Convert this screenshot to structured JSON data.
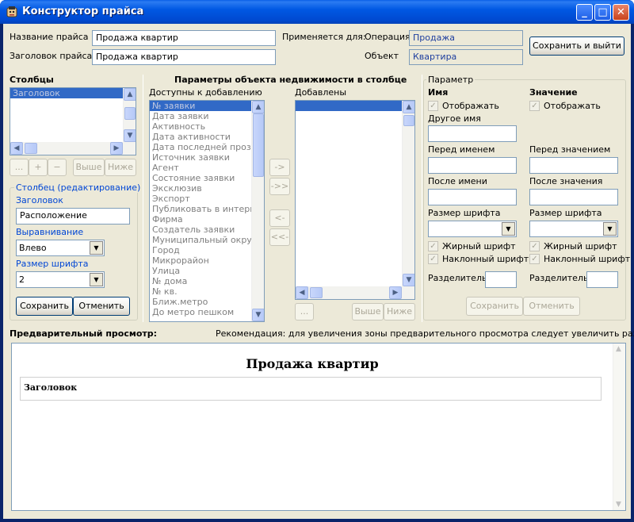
{
  "window": {
    "title": "Конструктор прайса",
    "minimize": "_",
    "maximize": "□",
    "close": "✕"
  },
  "header": {
    "price_name_label": "Название прайса",
    "price_name_value": "Продажа квартир",
    "price_title_label": "Заголовок прайса",
    "price_title_value": "Продажа квартир",
    "applies_label": "Применяется для:",
    "operation_label": "Операция",
    "operation_value": "Продажа",
    "object_label": "Объект",
    "object_value": "Квартира",
    "save_exit": "Сохранить и выйти"
  },
  "columns": {
    "title": "Столбцы",
    "items": [
      "Заголовок"
    ],
    "btn_more": "...",
    "btn_add": "+",
    "btn_remove": "−",
    "btn_up": "Выше",
    "btn_down": "Ниже"
  },
  "column_edit": {
    "title": "Столбец (редактирование)",
    "heading_label": "Заголовок",
    "heading_value": "Расположение",
    "align_label": "Выравнивание",
    "align_value": "Влево",
    "font_label": "Размер шрифта",
    "font_value": "2",
    "save": "Сохранить",
    "cancel": "Отменить"
  },
  "params": {
    "title": "Параметры объекта недвижимости в столбце",
    "available_label": "Доступны к добавлению",
    "available": [
      "№ заявки",
      "Дата заявки",
      "Активность",
      "Дата активности",
      "Дата последней прозво",
      "Источник заявки",
      "Агент",
      "Состояние заявки",
      "Эксклюзив",
      "Экспорт",
      "Публиковать в интернет",
      "Фирма",
      "Создатель заявки",
      "Муниципальный округ",
      "Город",
      "Микрорайон",
      "Улица",
      "№ дома",
      "№ кв.",
      "Ближ.метро",
      "До метро пешком"
    ],
    "added_label": "Добавлены",
    "arrow_add": "->",
    "arrow_add_all": "->>",
    "arrow_remove": "<-",
    "arrow_remove_all": "<<-",
    "btn_more": "...",
    "btn_up": "Выше",
    "btn_down": "Ниже"
  },
  "parameter": {
    "title": "Параметр",
    "name_header": "Имя",
    "value_header": "Значение",
    "show": "Отображать",
    "other_name": "Другое имя",
    "before_name": "Перед именем",
    "after_name": "После имени",
    "before_value": "Перед значением",
    "after_value": "После значения",
    "font_size": "Размер шрифта",
    "bold": "Жирный шрифт",
    "italic": "Наклонный шрифт",
    "separator": "Разделитель",
    "save": "Сохранить",
    "cancel": "Отменить",
    "check_mark": "✓"
  },
  "preview": {
    "label": "Предварительный просмотр:",
    "hint": "Рекомендация: для увеличения зоны предварительного просмотра следует увеличить размеры окна",
    "heading": "Продажа квартир",
    "table_header": "Заголовок"
  }
}
